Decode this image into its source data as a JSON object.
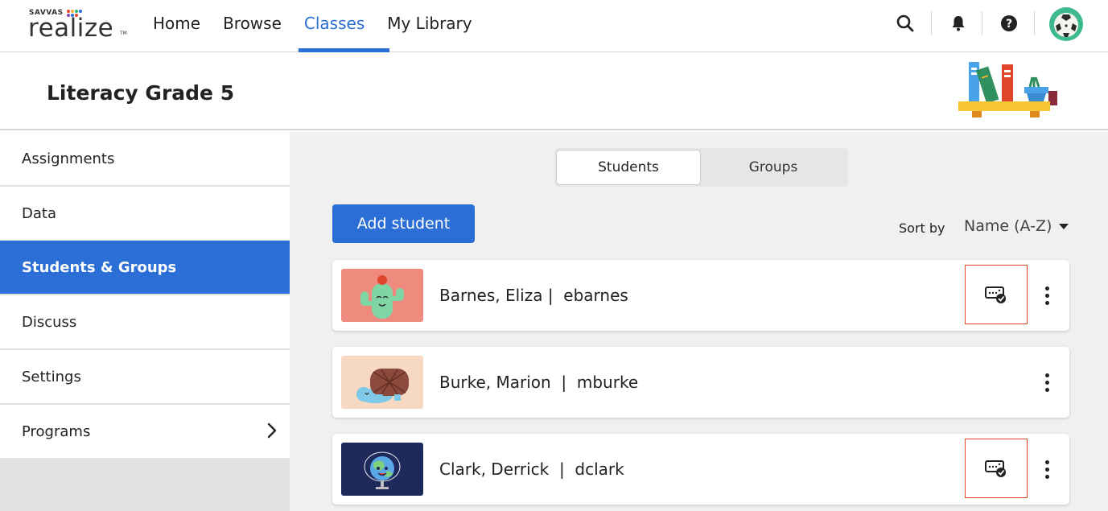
{
  "brand": {
    "savvas": "SAVVAS",
    "wordmark": "realize",
    "tm": "TM"
  },
  "nav": {
    "items": [
      {
        "label": "Home",
        "active": false
      },
      {
        "label": "Browse",
        "active": false
      },
      {
        "label": "Classes",
        "active": true
      },
      {
        "label": "My Library",
        "active": false
      }
    ],
    "icons": [
      "search-icon",
      "bell-icon",
      "help-icon",
      "user-avatar"
    ]
  },
  "class": {
    "title": "Literacy Grade 5"
  },
  "sidebar": {
    "items": [
      {
        "label": "Assignments",
        "active": false
      },
      {
        "label": "Data",
        "active": false
      },
      {
        "label": "Students & Groups",
        "active": true
      },
      {
        "label": "Discuss",
        "active": false
      },
      {
        "label": "Settings",
        "active": false
      },
      {
        "label": "Programs",
        "active": false,
        "has_chevron": true
      }
    ]
  },
  "main": {
    "tabs": [
      {
        "label": "Students",
        "active": true
      },
      {
        "label": "Groups",
        "active": false
      }
    ],
    "add_button": "Add student",
    "sort_label": "Sort by",
    "sort_value": "Name (A-Z)",
    "students": [
      {
        "name": "Barnes, Eliza |  ebarnes",
        "avatar": "cactus",
        "has_accommodation_icon": true
      },
      {
        "name": "Burke, Marion  |  mburke",
        "avatar": "turtle",
        "has_accommodation_icon": false
      },
      {
        "name": "Clark, Derrick  |  dclark",
        "avatar": "globe",
        "has_accommodation_icon": true
      }
    ]
  },
  "colors": {
    "accent": "#2b6fd6",
    "highlight_box": "#e0452a",
    "sidebar_bg": "#e2e2e2",
    "main_bg": "#f0f0f0"
  }
}
